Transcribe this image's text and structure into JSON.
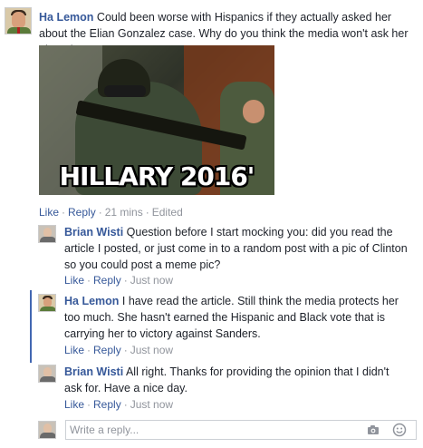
{
  "top_comment": {
    "author": "Ha Lemon",
    "text": " Could been worse with Hispanics if they actually asked her about the Elian Gonzalez case. Why do you think the media won't ask her about it?",
    "image_caption": "HILLARY 2016'",
    "actions": {
      "like": "Like",
      "reply": "Reply",
      "time": "21 mins",
      "edited": "Edited"
    }
  },
  "replies": [
    {
      "author": "Brian Wisti",
      "text": " Question before I start mocking you: did you read the article I posted, or just come in to a random post with a pic of Clinton so you could post a meme pic?",
      "actions": {
        "like": "Like",
        "reply": "Reply",
        "time": "Just now"
      }
    },
    {
      "author": "Ha Lemon",
      "text": " I have read the article. Still think the media protects her too much. She hasn't earned the Hispanic and Black vote that is carrying her to victory against Sanders.",
      "actions": {
        "like": "Like",
        "reply": "Reply",
        "time": "Just now"
      }
    },
    {
      "author": "Brian Wisti",
      "text": " All right. Thanks for providing the opinion that I didn't ask for. Have a nice day.",
      "actions": {
        "like": "Like",
        "reply": "Reply",
        "time": "Just now"
      }
    }
  ],
  "composer": {
    "placeholder": "Write a reply...",
    "icons": [
      "camera-icon",
      "smiley-icon"
    ]
  },
  "colors": {
    "link": "#365899",
    "muted": "#90949c",
    "reply_bar": "#4267b2"
  }
}
